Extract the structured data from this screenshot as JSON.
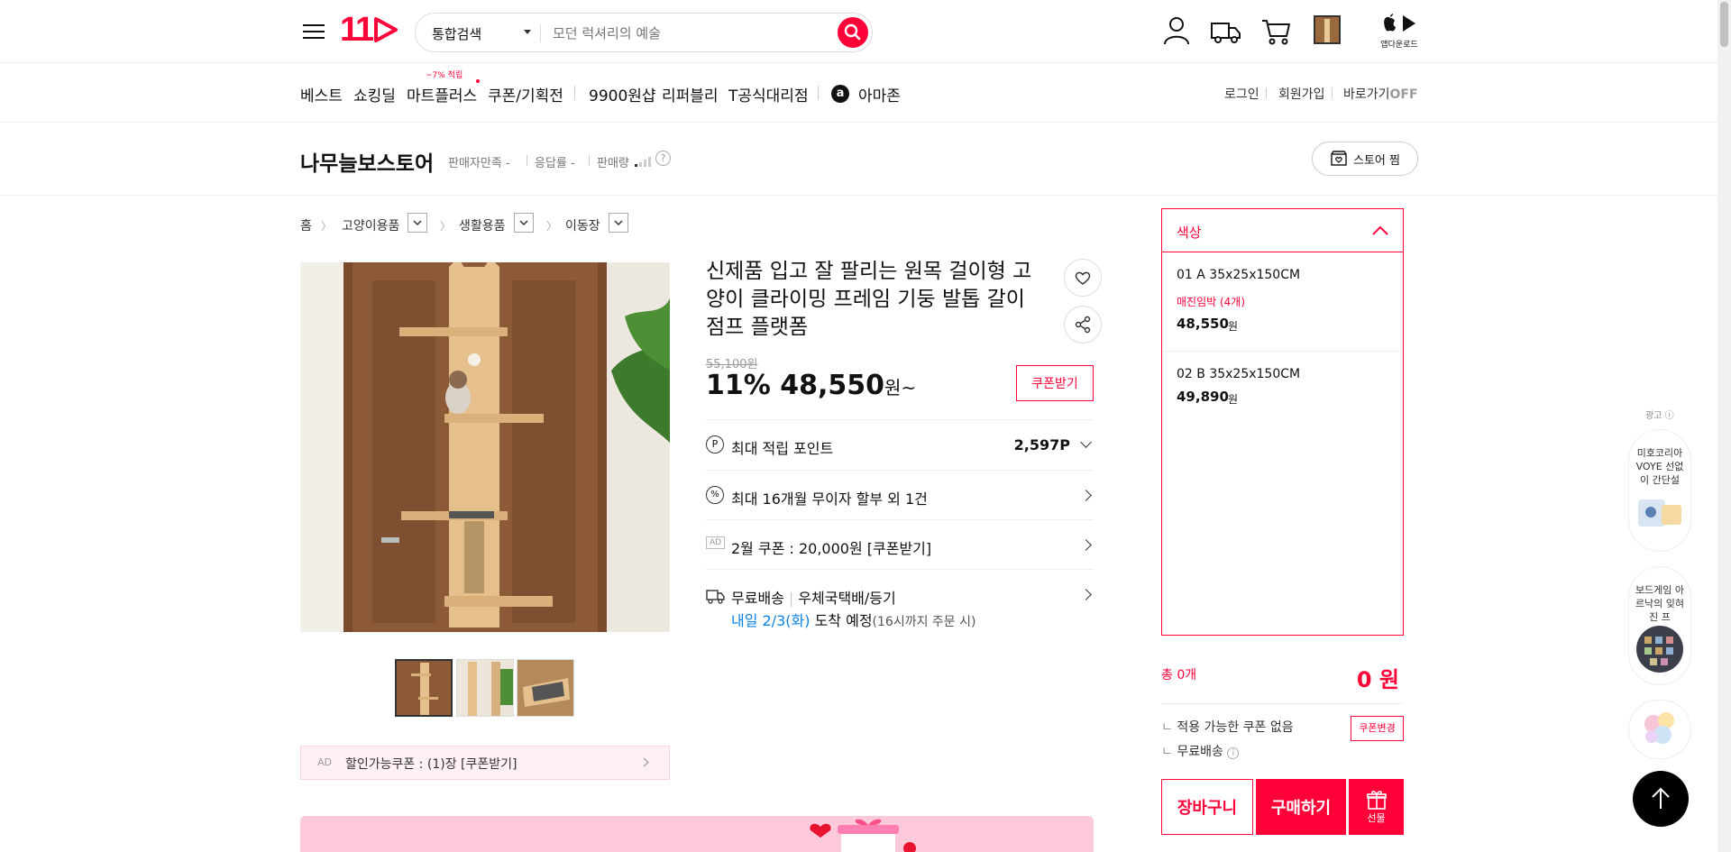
{
  "header": {
    "logo": "11",
    "search_type": "통합검색",
    "search_placeholder": "모던 럭셔리의 예술",
    "app_download": "앱다운로드"
  },
  "nav": {
    "items": [
      "베스트",
      "쇼킹딜",
      "마트플러스",
      "쿠폰/기획전",
      "9900원샵",
      "리퍼블리",
      "T공식대리점",
      "아마존"
    ],
    "mart_badge": "~7% 적립",
    "util": [
      "로그인",
      "회원가입",
      "바로가기"
    ],
    "shortcut_state": "OFF"
  },
  "store": {
    "name": "나무늘보스토어",
    "satisfaction": "판매자만족 -",
    "response": "응답률 -",
    "sales": "판매량",
    "fav_button": "스토어 찜"
  },
  "breadcrumb": [
    "홈",
    "고양이용품",
    "생활용품",
    "이동장"
  ],
  "product": {
    "title": "신제품 입고 잘 팔리는 원목 걸이형 고양이 클라이밍 프레임 기둥 발톱 갈이 점프 플랫폼",
    "original_price": "55,100원",
    "discount": "11%",
    "price": "48,550",
    "price_unit": "원~",
    "coupon_button": "쿠폰받기",
    "points_label": "최대 적립 포인트",
    "points_value": "2,597P",
    "installment": "최대 16개월 무이자 할부 외 1건",
    "ad_badge": "AD",
    "ad_coupon": "2월 쿠폰 : 20,000원 [쿠폰받기]",
    "delivery_free": "무료배송",
    "delivery_method": "우체국택배/등기",
    "delivery_date": "내일 2/3(화)",
    "delivery_arrive": "도착 예정",
    "delivery_cutoff": "(16시까지 주문 시)",
    "discount_coupon_ad": "AD",
    "discount_coupon_label": "할인가능쿠폰 : (1)장 [쿠폰받기]"
  },
  "options": {
    "title": "색상",
    "items": [
      {
        "name": "01 A 35x25x150CM",
        "tag": "매진임박 (4개)",
        "price": "48,550",
        "unit": "원"
      },
      {
        "name": "02 B 35x25x150CM",
        "tag": "",
        "price": "49,890",
        "unit": "원"
      }
    ]
  },
  "summary": {
    "total": "총 0개",
    "amount": "0 원",
    "coupon_none": "적용 가능한 쿠폰 없음",
    "coupon_change": "쿠폰변경",
    "free_ship": "무료배송",
    "cart": "장바구니",
    "buy": "구매하기",
    "gift": "선물"
  },
  "side_ads": {
    "label": "광고",
    "items": [
      "미호코리아 VOYE 선없이 간단설",
      "보드게임 아르낙의 잊혀진 프"
    ]
  },
  "colors": {
    "brand": "#ff0038",
    "link": "#0b83e6"
  }
}
